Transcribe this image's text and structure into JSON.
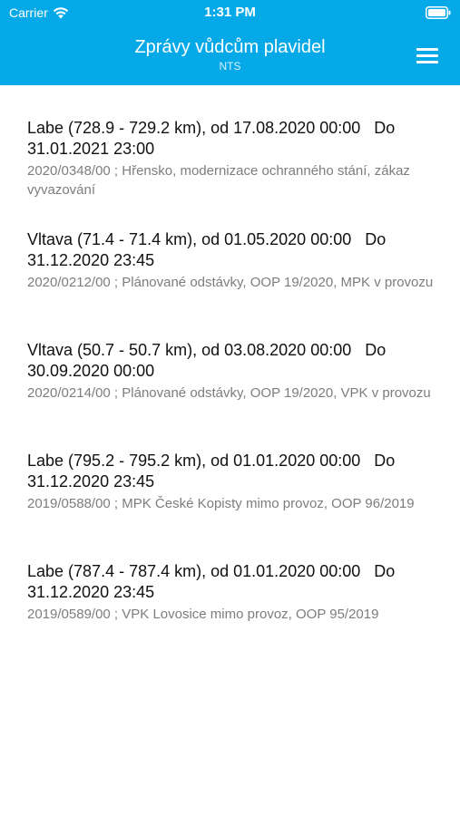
{
  "status_bar": {
    "carrier": "Carrier",
    "time": "1:31 PM"
  },
  "header": {
    "title": "Zprávy vůdcům plavidel",
    "subtitle": "NTS",
    "menu_icon": "hamburger-menu-icon",
    "background_color": "#05a9e7"
  },
  "messages": [
    {
      "title": "Labe (728.9 - 729.2 km), od 17.08.2020 00:00   Do 31.01.2021 23:00",
      "description": "2020/0348/00 ; Hřensko, modernizace ochranného stání, zákaz vyvazování"
    },
    {
      "title": "Vltava (71.4 - 71.4 km), od 01.05.2020 00:00   Do 31.12.2020 23:45",
      "description": "2020/0212/00 ; Plánované odstávky, OOP 19/2020, MPK v provozu"
    },
    {
      "title": "Vltava (50.7 - 50.7 km), od 03.08.2020 00:00   Do 30.09.2020 00:00",
      "description": "2020/0214/00 ; Plánované odstávky, OOP 19/2020, VPK v provozu"
    },
    {
      "title": "Labe (795.2 - 795.2 km), od 01.01.2020 00:00   Do 31.12.2020 23:45",
      "description": "2019/0588/00 ; MPK České Kopisty mimo provoz, OOP 96/2019"
    },
    {
      "title": "Labe (787.4 - 787.4 km), od 01.01.2020 00:00   Do 31.12.2020 23:45",
      "description": "2019/0589/00 ; VPK Lovosice mimo provoz, OOP 95/2019"
    }
  ]
}
